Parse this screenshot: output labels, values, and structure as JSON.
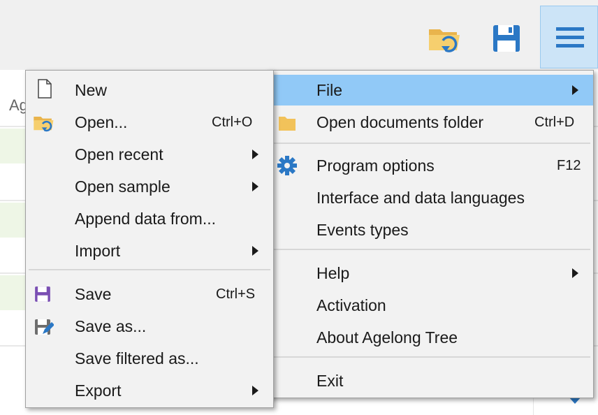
{
  "background": {
    "column_header_partial": "Ag"
  },
  "toolbar": {
    "buttons": [
      {
        "name": "open-folder",
        "icon": "folder-open-icon"
      },
      {
        "name": "save",
        "icon": "floppy-disk-icon"
      },
      {
        "name": "main-menu",
        "icon": "hamburger-menu-icon",
        "active": true
      }
    ]
  },
  "main_menu": {
    "items": [
      {
        "label": "File",
        "highlighted": true,
        "submenu": true
      },
      {
        "label": "Open documents folder",
        "shortcut": "Ctrl+D",
        "icon": "folder-icon"
      },
      {
        "label": "Program options",
        "shortcut": "F12",
        "icon": "gear-icon"
      },
      {
        "label": "Interface and data languages"
      },
      {
        "label": "Events types"
      },
      {
        "label": "Help",
        "submenu": true
      },
      {
        "label": "Activation"
      },
      {
        "label": "About Agelong Tree"
      },
      {
        "label": "Exit"
      }
    ]
  },
  "file_menu": {
    "items": [
      {
        "label": "New",
        "icon": "new-document-icon"
      },
      {
        "label": "Open...",
        "shortcut": "Ctrl+O",
        "icon": "folder-open-icon"
      },
      {
        "label": "Open recent",
        "submenu": true
      },
      {
        "label": "Open sample",
        "submenu": true
      },
      {
        "label": "Append data from..."
      },
      {
        "label": "Import",
        "submenu": true
      },
      {
        "label": "Save",
        "shortcut": "Ctrl+S",
        "icon": "floppy-disk-icon"
      },
      {
        "label": "Save as...",
        "icon": "save-as-icon"
      },
      {
        "label": "Save filtered as..."
      },
      {
        "label": "Export",
        "submenu": true
      }
    ]
  },
  "colors": {
    "highlight": "#91c9f7",
    "accent_blue": "#2b78c5",
    "save_purple": "#7a4fb3",
    "folder_yellow": "#f2c25a"
  }
}
